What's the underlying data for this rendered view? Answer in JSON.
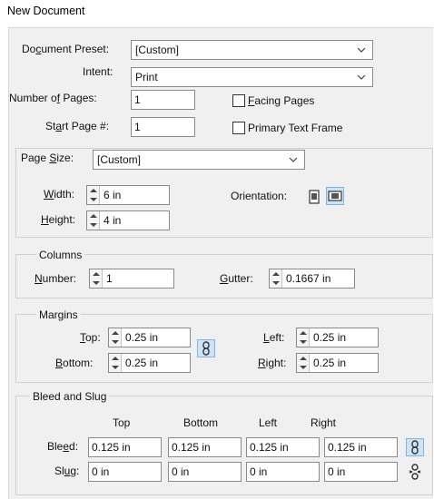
{
  "window": {
    "title": "New Document"
  },
  "document": {
    "preset_label": "Document Preset:",
    "preset_value": "[Custom]",
    "intent_label": "Intent:",
    "intent_value": "Print",
    "pages_label": "Number of Pages:",
    "pages_value": "1",
    "start_label": "Start Page #:",
    "start_value": "1",
    "facing_label": "Facing Pages",
    "facing_checked": false,
    "primary_label": "Primary Text Frame",
    "primary_checked": false
  },
  "page_size": {
    "label": "Page Size:",
    "value": "[Custom]",
    "width_label": "Width:",
    "width_value": "6 in",
    "height_label": "Height:",
    "height_value": "4 in",
    "orientation_label": "Orientation:",
    "orientation_selected": "landscape"
  },
  "columns": {
    "group_label": "Columns",
    "number_label": "Number:",
    "number_value": "1",
    "gutter_label": "Gutter:",
    "gutter_value": "0.1667 in"
  },
  "margins": {
    "group_label": "Margins",
    "top_label": "Top:",
    "top_value": "0.25 in",
    "bottom_label": "Bottom:",
    "bottom_value": "0.25 in",
    "left_label": "Left:",
    "left_value": "0.25 in",
    "right_label": "Right:",
    "right_value": "0.25 in"
  },
  "bleed_slug": {
    "group_label": "Bleed and Slug",
    "headers": [
      "Top",
      "Bottom",
      "Left",
      "Right"
    ],
    "bleed_label": "Bleed:",
    "bleed_values": [
      "0.125 in",
      "0.125 in",
      "0.125 in",
      "0.125 in"
    ],
    "slug_label": "Slug:",
    "slug_values": [
      "0 in",
      "0 in",
      "0 in",
      "0 in"
    ]
  },
  "colors": {
    "selected_bg": "#cce4f7",
    "selected_border": "#7fb5e0",
    "panel_bg": "#f0f0f0"
  }
}
